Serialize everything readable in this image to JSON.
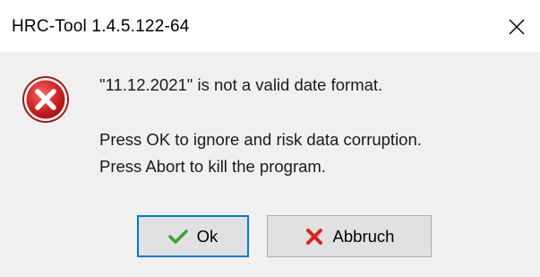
{
  "window": {
    "title": "HRC-Tool 1.4.5.122-64",
    "close_icon": "close-icon"
  },
  "message": {
    "icon": "error-icon",
    "line1": "\"11.12.2021\" is not a valid date format.",
    "line2": "Press OK to ignore and risk data corruption.",
    "line3": "Press Abort to kill the program."
  },
  "buttons": {
    "ok_label": "Ok",
    "ok_icon": "check-icon",
    "abort_label": "Abbruch",
    "abort_icon": "x-icon"
  },
  "colors": {
    "error_red": "#d42a2a",
    "check_green": "#3aa335",
    "x_red": "#e02020",
    "focus_border": "#0078d7"
  }
}
